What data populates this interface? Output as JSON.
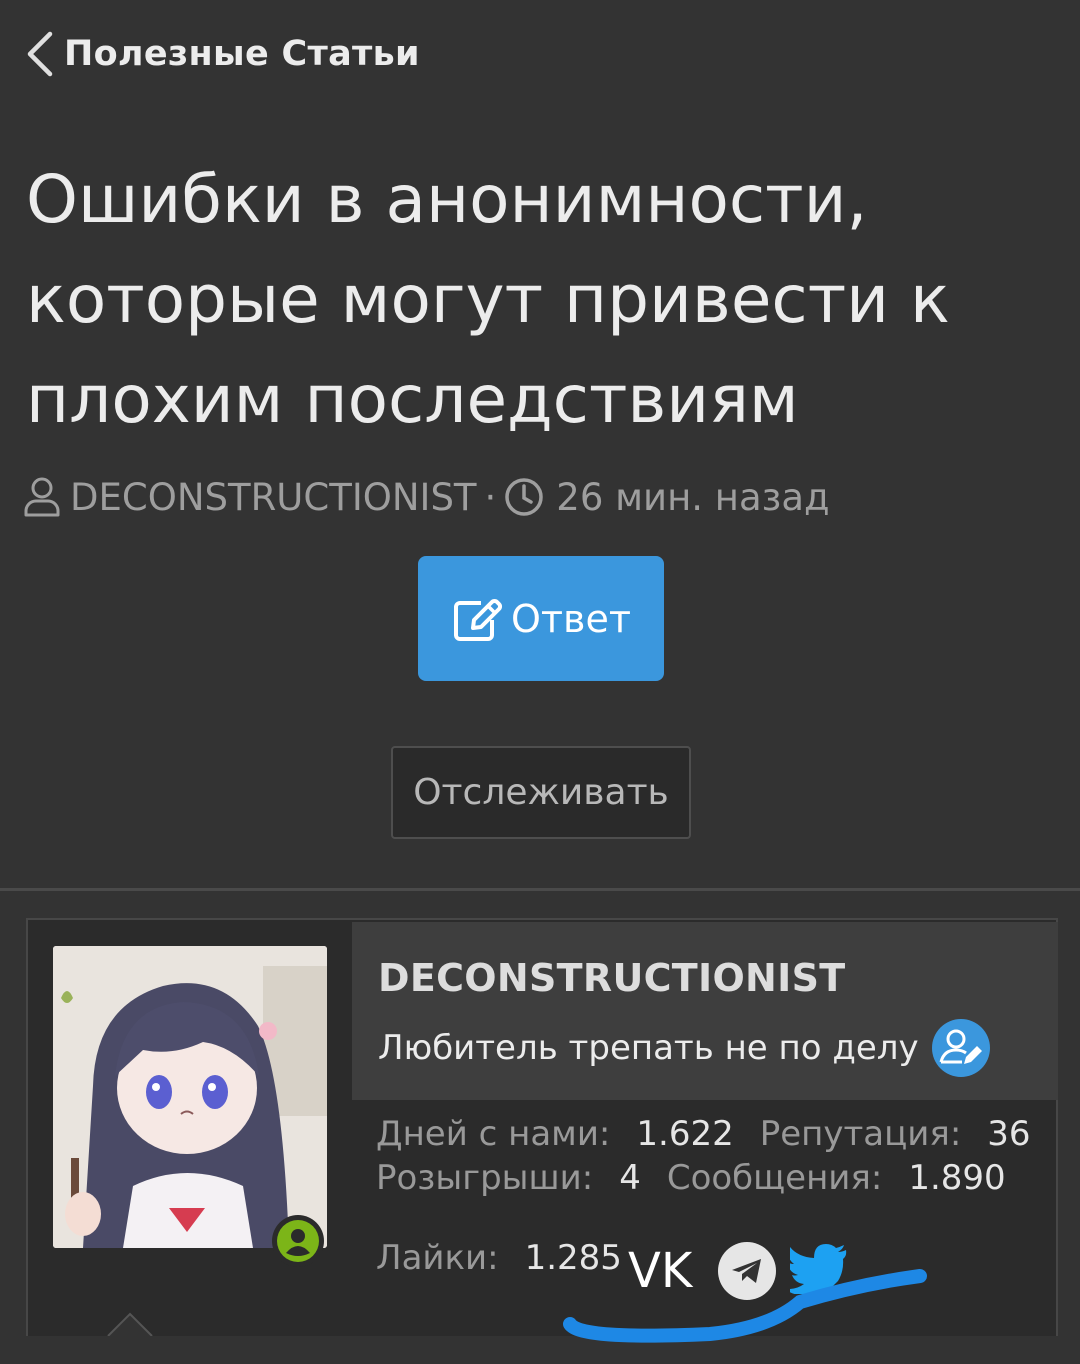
{
  "breadcrumb": {
    "label": "Полезные Статьи"
  },
  "thread": {
    "title": "Ошибки в анонимности, которые могут привести к плохим последствиям",
    "author": "DECONSTRUCTIONIST",
    "separator": "·",
    "time": "26 мин. назад"
  },
  "actions": {
    "reply_label": "Ответ",
    "follow_label": "Отслеживать"
  },
  "user_card": {
    "username": "DECONSTRUCTIONIST",
    "user_title": "Любитель трепать не по делу",
    "stats": {
      "days_label": "Дней с нами:",
      "days_value": "1.622",
      "rep_label": "Репутация:",
      "rep_value": "36",
      "giveaways_label": "Розыгрыши:",
      "giveaways_value": "4",
      "messages_label": "Сообщения:",
      "messages_value": "1.890",
      "likes_label": "Лайки:",
      "likes_value": "1.285"
    },
    "socials": {
      "vk_label": "VK",
      "icons": [
        "telegram-icon",
        "twitter-icon"
      ]
    },
    "online": true
  },
  "colors": {
    "background": "#333333",
    "accent": "#3b97dd",
    "online": "#7cb518",
    "highlight_stroke": "#1e88e5"
  }
}
